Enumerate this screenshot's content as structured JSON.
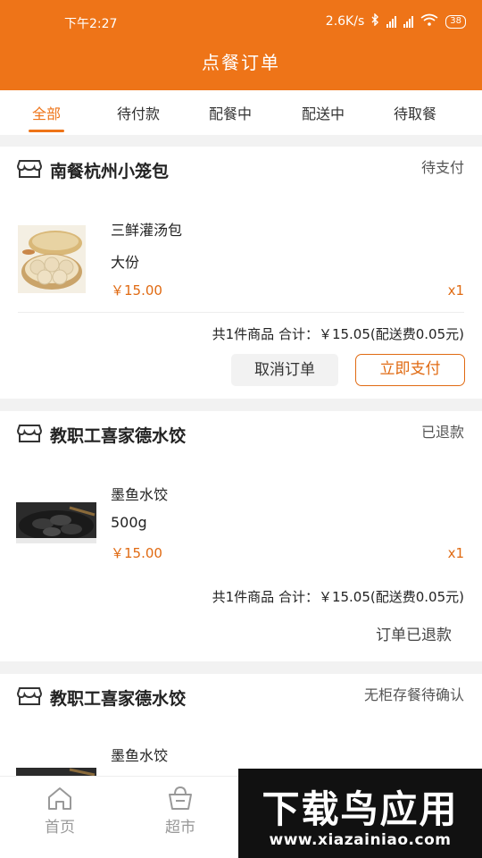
{
  "status_bar": {
    "time": "下午2:27",
    "network_speed": "2.6K/s",
    "battery": "38"
  },
  "header": {
    "title": "点餐订单"
  },
  "tabs": [
    {
      "label": "全部",
      "active": true
    },
    {
      "label": "待付款",
      "active": false
    },
    {
      "label": "配餐中",
      "active": false
    },
    {
      "label": "配送中",
      "active": false
    },
    {
      "label": "待取餐",
      "active": false
    }
  ],
  "orders": [
    {
      "store": "南餐杭州小笼包",
      "status": "待支付",
      "item": {
        "name": "三鲜灌汤包",
        "spec": "大份",
        "price": "￥15.00",
        "qty": "x1"
      },
      "summary": "共1件商品 合计：￥15.05(配送费0.05元)",
      "actions": {
        "cancel": "取消订单",
        "pay": "立即支付"
      }
    },
    {
      "store": "教职工喜家德水饺",
      "status": "已退款",
      "item": {
        "name": "墨鱼水饺",
        "spec": "500g",
        "price": "￥15.00",
        "qty": "x1"
      },
      "summary": "共1件商品 合计：￥15.05(配送费0.05元)",
      "refund_text": "订单已退款"
    },
    {
      "store": "教职工喜家德水饺",
      "status": "无柜存餐待确认",
      "item": {
        "name": "墨鱼水饺"
      }
    }
  ],
  "bottom_nav": [
    {
      "label": "首页",
      "icon": "home-icon"
    },
    {
      "label": "超市",
      "icon": "basket-icon"
    }
  ],
  "watermark": {
    "logo": "下载鸟应用",
    "url": "www.xiazainiao.com"
  },
  "colors": {
    "brand": "#ee7418",
    "price": "#e06a12",
    "watermark_green": "#22c35e"
  }
}
